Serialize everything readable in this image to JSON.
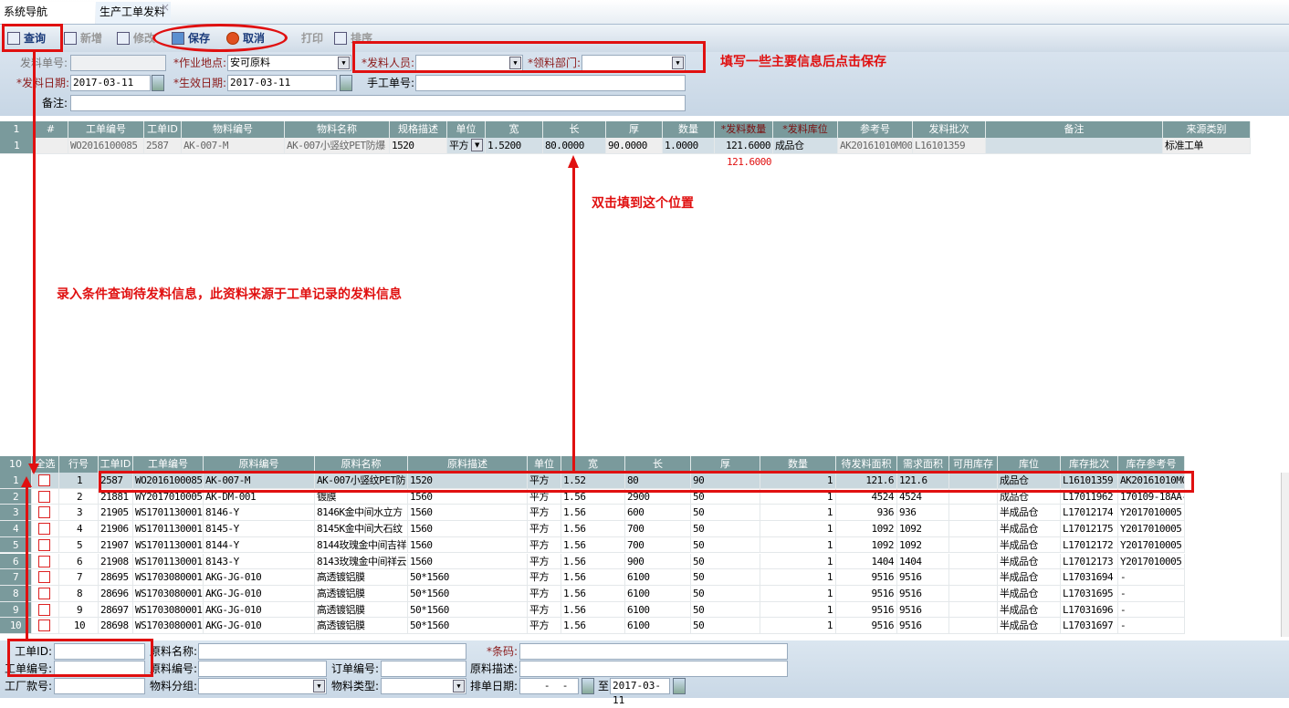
{
  "tabs": [
    {
      "label": "系统导航"
    },
    {
      "label": "生产工单发料",
      "close": "×"
    }
  ],
  "toolbar": {
    "query": "查询",
    "add": "新增",
    "edit": "修改",
    "save": "保存",
    "cancel": "取消",
    "print": "打印",
    "sort": "排序"
  },
  "form": {
    "issue_no_label": "发料单号:",
    "issue_no": "",
    "site_label": "*作业地点:",
    "site": "安可原料",
    "issuer_label": "*发料人员:",
    "issuer": "",
    "dept_label": "*领料部门:",
    "dept": "",
    "issue_date_label": "*发料日期:",
    "issue_date": "2017-03-11",
    "effective_date_label": "*生效日期:",
    "effective_date": "2017-03-11",
    "manual_no_label": "手工单号:",
    "manual_no": "",
    "remark_label": "备注:",
    "remark": ""
  },
  "top_grid": {
    "count": "1",
    "hash": "#",
    "headers": [
      "工单编号",
      "工单ID",
      "物料编号",
      "物料名称",
      "规格描述",
      "单位",
      "宽",
      "长",
      "厚",
      "数量",
      "*发料数量",
      "*发料库位",
      "参考号",
      "发料批次",
      "备注",
      "来源类别"
    ],
    "rows": [
      [
        "WO2016100085",
        "2587",
        "AK-007-M",
        "AK-007小竖纹PET防爆",
        "1520",
        "平方",
        "1.5200",
        "80.0000",
        "90.0000",
        "1.0000",
        "121.6000",
        "成品仓",
        "AK20161010M00",
        "L16101359",
        "",
        "标准工单"
      ]
    ],
    "total": "121.6000"
  },
  "bottom_grid": {
    "count": "10",
    "headers": [
      "全选",
      "行号",
      "工单ID",
      "工单编号",
      "原料编号",
      "原料名称",
      "原料描述",
      "单位",
      "宽",
      "长",
      "厚",
      "数量",
      "待发料面积",
      "需求面积",
      "可用库存",
      "库位",
      "库存批次",
      "库存参考号"
    ],
    "rows": [
      [
        "1",
        "2587",
        "WO2016100085",
        "AK-007-M",
        "AK-007小竖纹PET防",
        "1520",
        "平方",
        "1.52",
        "80",
        "90",
        "1",
        "121.6",
        "121.6",
        "",
        "成品仓",
        "L16101359",
        "AK20161010M0"
      ],
      [
        "2",
        "21881",
        "WY2017010005",
        "AK-DM-001",
        "镀膜",
        "1560",
        "平方",
        "1.56",
        "2900",
        "50",
        "1",
        "4524",
        "4524",
        "",
        "成品仓",
        "L17011962",
        "170109-18AA-"
      ],
      [
        "3",
        "21905",
        "WS1701130001",
        "8146-Y",
        "8146K金中间水立方",
        "1560",
        "平方",
        "1.56",
        "600",
        "50",
        "1",
        "936",
        "936",
        "",
        "半成品仓",
        "L17012174",
        "Y2017010005"
      ],
      [
        "4",
        "21906",
        "WS1701130001",
        "8145-Y",
        "8145K金中间大石纹",
        "1560",
        "平方",
        "1.56",
        "700",
        "50",
        "1",
        "1092",
        "1092",
        "",
        "半成品仓",
        "L17012175",
        "Y2017010005"
      ],
      [
        "5",
        "21907",
        "WS1701130001",
        "8144-Y",
        "8144玫瑰金中间吉祥",
        "1560",
        "平方",
        "1.56",
        "700",
        "50",
        "1",
        "1092",
        "1092",
        "",
        "半成品仓",
        "L17012172",
        "Y2017010005"
      ],
      [
        "6",
        "21908",
        "WS1701130001",
        "8143-Y",
        "8143玫瑰金中间祥云",
        "1560",
        "平方",
        "1.56",
        "900",
        "50",
        "1",
        "1404",
        "1404",
        "",
        "半成品仓",
        "L17012173",
        "Y2017010005"
      ],
      [
        "7",
        "28695",
        "WS1703080001",
        "AKG-JG-010",
        "高透镀铝膜",
        "50*1560",
        "平方",
        "1.56",
        "6100",
        "50",
        "1",
        "9516",
        "9516",
        "",
        "半成品仓",
        "L17031694",
        "-"
      ],
      [
        "8",
        "28696",
        "WS1703080001",
        "AKG-JG-010",
        "高透镀铝膜",
        "50*1560",
        "平方",
        "1.56",
        "6100",
        "50",
        "1",
        "9516",
        "9516",
        "",
        "半成品仓",
        "L17031695",
        "-"
      ],
      [
        "9",
        "28697",
        "WS1703080001",
        "AKG-JG-010",
        "高透镀铝膜",
        "50*1560",
        "平方",
        "1.56",
        "6100",
        "50",
        "1",
        "9516",
        "9516",
        "",
        "半成品仓",
        "L17031696",
        "-"
      ],
      [
        "10",
        "28698",
        "WS1703080001",
        "AKG-JG-010",
        "高透镀铝膜",
        "50*1560",
        "平方",
        "1.56",
        "6100",
        "50",
        "1",
        "9516",
        "9516",
        "",
        "半成品仓",
        "L17031697",
        "-"
      ]
    ]
  },
  "filter": {
    "order_id_label": "工单ID:",
    "material_name_label": "原料名称:",
    "barcode_label": "*条码:",
    "order_no_label": "工单编号:",
    "material_no_label": "原料编号:",
    "sales_order_label": "订单编号:",
    "material_desc_label": "原料描述:",
    "factory_no_label": "工厂款号:",
    "material_group_label": "物料分组:",
    "material_type_label": "物料类型:",
    "schedule_date_label": "排单日期:",
    "date_from": "  -  -",
    "to_label": "至",
    "date_to": "2017-03-11"
  },
  "annotations": {
    "fill_save": "填写一些主要信息后点击保存",
    "double_click": "双击填到这个位置",
    "query_hint": "录入条件查询待发料信息，此资料来源于工单记录的发料信息"
  },
  "colors": {
    "annotation": "#e01010",
    "grid_header": "#7a9a9c",
    "required": "#8b1a1a"
  }
}
